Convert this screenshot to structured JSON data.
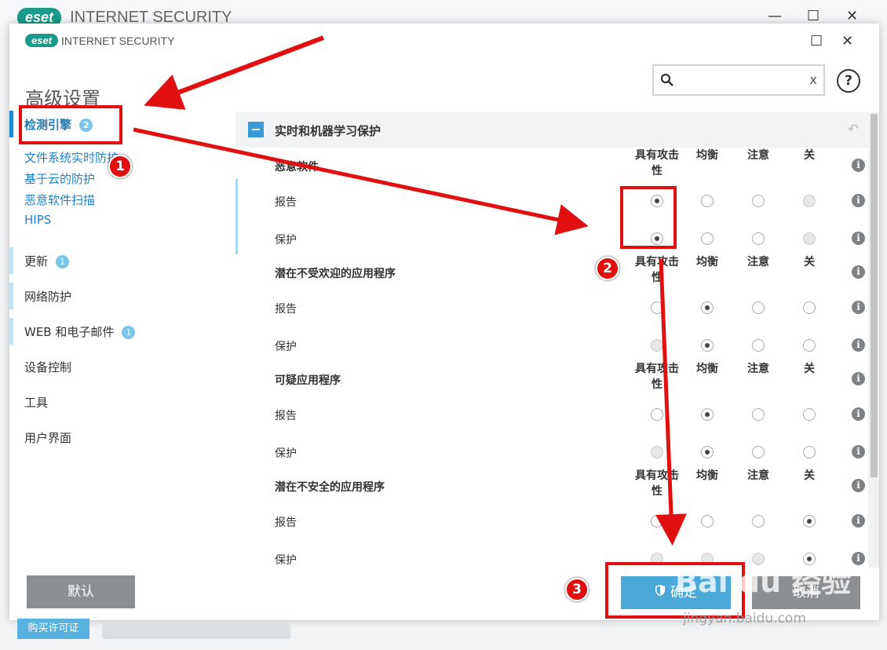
{
  "background_window": {
    "logo": "eset",
    "title": "INTERNET SECURITY"
  },
  "dialog": {
    "logo": "eset",
    "app_name": "INTERNET SECURITY",
    "page_title": "高级设置",
    "search": {
      "placeholder": "",
      "clear": "x"
    },
    "help": "?"
  },
  "sidebar": {
    "detection": {
      "label": "检测引擎",
      "badge": "2"
    },
    "sub_items": [
      "文件系统实时防护",
      "基于云的防护",
      "恶意软件扫描",
      "HIPS"
    ],
    "items": [
      {
        "label": "更新",
        "badge": "1"
      },
      {
        "label": "网络防护",
        "badge": ""
      },
      {
        "label": "WEB 和电子邮件",
        "badge": "1"
      },
      {
        "label": "设备控制",
        "badge": ""
      },
      {
        "label": "工具",
        "badge": ""
      },
      {
        "label": "用户界面",
        "badge": ""
      }
    ]
  },
  "section": {
    "title": "实时和机器学习保护",
    "collapse": "−"
  },
  "column_headers": [
    "具有攻击性",
    "均衡",
    "注意",
    "关"
  ],
  "categories": [
    {
      "title": "恶意软件",
      "rows": [
        {
          "label": "报告",
          "selected": 0,
          "disabled": [
            3
          ]
        },
        {
          "label": "保护",
          "selected": 0,
          "disabled": [
            3
          ]
        }
      ]
    },
    {
      "title": "潜在不受欢迎的应用程序",
      "rows": [
        {
          "label": "报告",
          "selected": 1,
          "disabled": []
        },
        {
          "label": "保护",
          "selected": 1,
          "disabled": [
            0
          ]
        }
      ]
    },
    {
      "title": "可疑应用程序",
      "rows": [
        {
          "label": "报告",
          "selected": 1,
          "disabled": []
        },
        {
          "label": "保护",
          "selected": 1,
          "disabled": [
            0
          ]
        }
      ]
    },
    {
      "title": "潜在不安全的应用程序",
      "rows": [
        {
          "label": "报告",
          "selected": 3,
          "disabled": []
        },
        {
          "label": "保护",
          "selected": 3,
          "disabled": [
            0,
            1,
            2
          ]
        }
      ]
    }
  ],
  "buttons": {
    "default": "默认",
    "ok": "确定",
    "cancel": "取消"
  },
  "footer": {
    "buy": "购买许可证"
  },
  "annotations": [
    "1",
    "2",
    "3"
  ],
  "watermark": {
    "brand": "Bai du 经验",
    "url": "jingyan.baidu.com"
  },
  "colors": {
    "accent": "#1f82c4",
    "badge": "#79c6eb",
    "annotation": "#e01010",
    "ok_button": "#4aa9d8"
  }
}
